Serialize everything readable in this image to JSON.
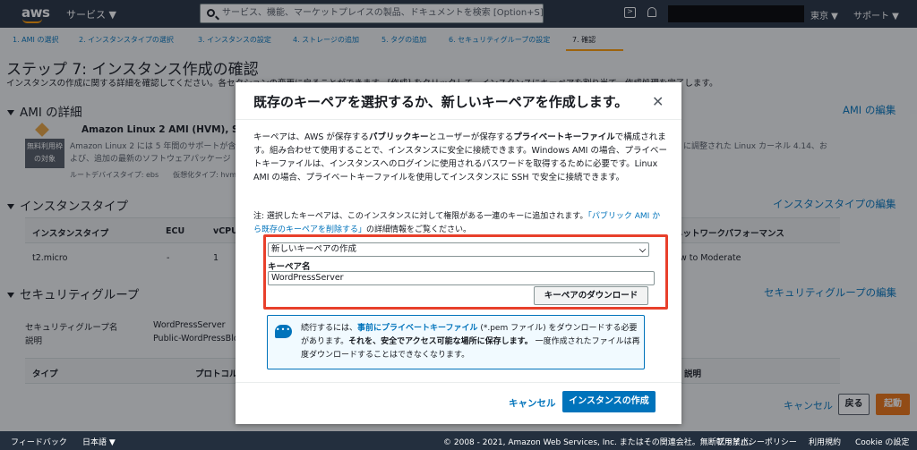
{
  "nav": {
    "logo": "aws",
    "services": "サービス ▼",
    "search_placeholder": "サービス、機能、マーケットプレイスの製品、ドキュメントを検索",
    "search_shortcut": "[Option+S]",
    "region": "東京 ▼",
    "support": "サポート ▼"
  },
  "steps": [
    "1. AMI の選択",
    "2. インスタンスタイプの選択",
    "3. インスタンスの設定",
    "4. ストレージの追加",
    "5. タグの追加",
    "6. セキュリティグループの設定",
    "7. 確認"
  ],
  "page": {
    "title": "ステップ 7: インスタンス作成の確認",
    "description": "インスタンスの作成に関する詳細を確認してください。各セクションの変更に戻ることができます。[作成] をクリックして、インスタンスにキーペアを割り当て、作成処理を完了します。"
  },
  "ami": {
    "heading": "AMI の詳細",
    "edit": "AMI の編集",
    "name": "Amazon Linux 2 AMI (HVM), SSD Vol",
    "free_tier_1": "無料利用枠",
    "free_tier_2": "の対象",
    "desc_1": "Amazon Linux 2 には 5 年間のサポートが含",
    "desc_2": "よび、追加の最新のソフトウェアパッケージ",
    "desc_right": "に調整された Linux カーネル 4.14、お",
    "meta": "ルートデバイスタイプ: ebs　　仮想化タイプ: hvm"
  },
  "instance_type": {
    "heading": "インスタンスタイプ",
    "edit": "インスタンスタイプの編集",
    "columns": [
      "インスタンスタイプ",
      "ECU",
      "vCPU",
      "ネットワークパフォーマンス"
    ],
    "row": [
      "t2.micro",
      "-",
      "1",
      "Low to Moderate"
    ]
  },
  "security": {
    "heading": "セキュリティグループ",
    "edit": "セキュリティグループの編集",
    "name_label": "セキュリティグループ名",
    "name_value": "WordPressServer",
    "desc_label": "説明",
    "desc_value": "Public-WordPressBlo",
    "columns": [
      "タイプ",
      "プロトコル",
      "説明"
    ]
  },
  "bottom": {
    "cancel": "キャンセル",
    "back": "戻る",
    "launch": "起動"
  },
  "footer": {
    "feedback": "フィードバック",
    "language": "日本語 ▼",
    "copyright": "© 2008 - 2021, Amazon Web Services, Inc. またはその関連会社。無断転用禁止。",
    "privacy": "プライバシーポリシー",
    "terms": "利用規約",
    "cookie": "Cookie の設定"
  },
  "modal": {
    "title": "既存のキーペアを選択するか、新しいキーペアを作成します。",
    "body_1": "キーペアは、AWS が保存する",
    "body_public": "パブリックキー",
    "body_2": "とユーザーが保存する",
    "body_private": "プライベートキーファイル",
    "body_3": "で構成されます。組み合わせて使用することで、インスタンスに安全に接続できます。Windows AMI の場合、プライベートキーファイルは、インスタンスへのログインに使用されるパスワードを取得するために必要です。Linux AMI の場合、プライベートキーファイルを使用してインスタンスに SSH で安全に接続できます。",
    "note_1": "注: 選択したキーペアは、このインスタンスに対して権限がある一連のキーに追加されます。",
    "note_link": "「パブリック AMI から既存のキーペアを削除する」",
    "note_2": "の詳細情報をご覧ください。",
    "select_value": "新しいキーペアの作成",
    "keypair_label": "キーペア名",
    "keypair_value": "WordPressServer",
    "download_button": "キーペアのダウンロード",
    "info_1": "続行するには、",
    "info_em1": "事前にプライベートキーファイル",
    "info_2": " (*.pem ファイル) をダウンロードする必要があります。",
    "info_bold": "それを、安全でアクセス可能な場所に保存します。",
    "info_3": " 一度作成されたファイルは再度ダウンロードすることはできなくなります。",
    "cancel": "キャンセル",
    "launch": "インスタンスの作成"
  },
  "colors": {
    "nav_bg": "#232f3e",
    "accent_orange": "#ec7211",
    "link_blue": "#0073bb",
    "highlight_red": "#e8402b"
  }
}
